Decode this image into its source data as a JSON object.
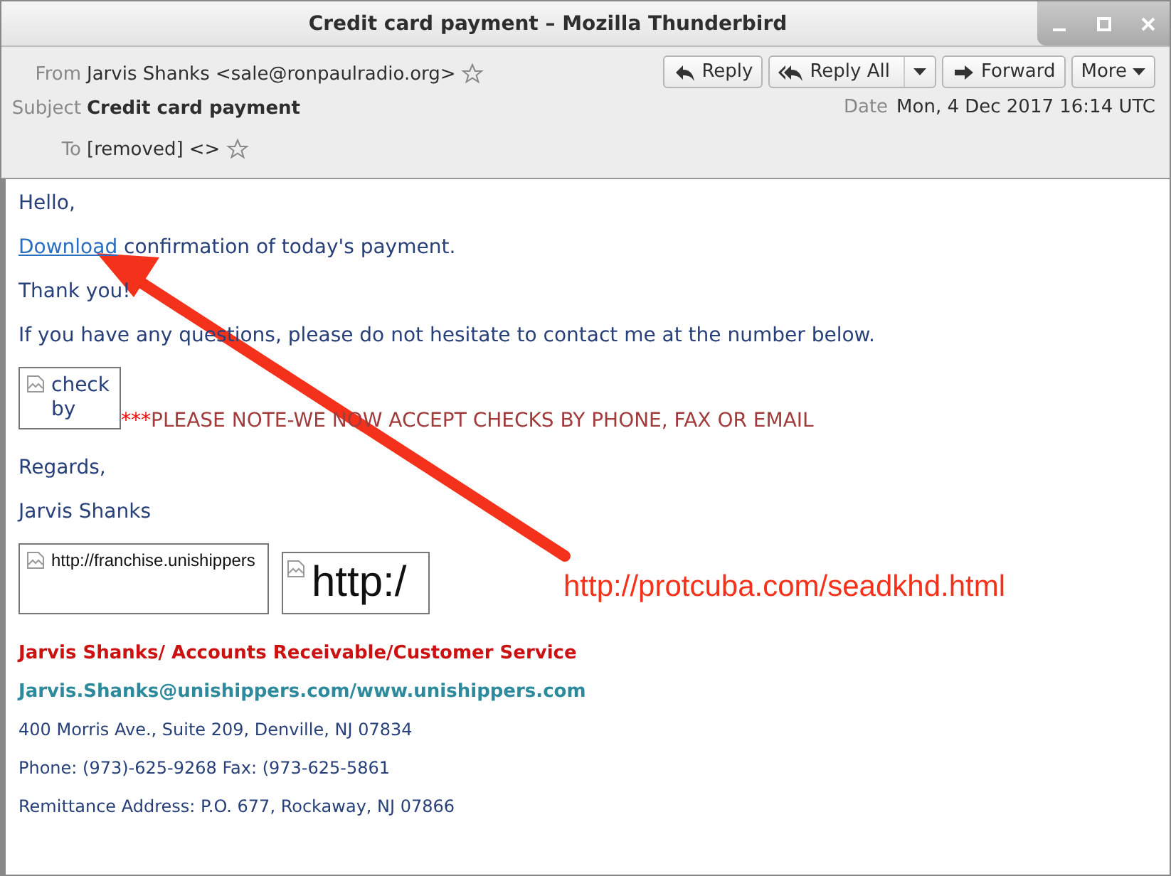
{
  "window": {
    "title": "Credit card payment – Mozilla Thunderbird",
    "controls": [
      {
        "kind": "minimize"
      },
      {
        "kind": "maximize"
      },
      {
        "kind": "close"
      }
    ]
  },
  "header": {
    "fields": [
      {
        "kind": "from",
        "label": "From",
        "value": "Jarvis Shanks <sale@ronpaulradio.org>",
        "starred": false
      },
      {
        "kind": "subject",
        "label": "Subject",
        "value": "Credit card payment"
      },
      {
        "kind": "to",
        "label": "To",
        "value": "[removed] <>",
        "starred": false
      }
    ],
    "date": {
      "label": "Date",
      "value": "Mon, 4 Dec 2017 16:14 UTC"
    },
    "buttons": [
      {
        "kind": "reply",
        "label": "Reply"
      },
      {
        "kind": "reply-all",
        "label": "Reply All"
      },
      {
        "kind": "forward",
        "label": "Forward"
      },
      {
        "kind": "more",
        "label": "More"
      }
    ]
  },
  "body": [
    {
      "kind": "text",
      "text": "Hello,"
    },
    {
      "kind": "link",
      "link": "Download",
      "text": "confirmation of today's payment."
    },
    {
      "kind": "text",
      "text": "Thank you!"
    },
    {
      "kind": "text",
      "text": "If you have any questions, please do not hesitate to contact me at the number below."
    },
    {
      "kind": "notice",
      "image_alt": "check by",
      "marks": "***",
      "text": "PLEASE NOTE-WE NOW ACCEPT CHECKS BY PHONE, FAX OR EMAIL"
    },
    {
      "kind": "text",
      "text": "Regards,"
    },
    {
      "kind": "text",
      "text": "Jarvis Shanks"
    },
    {
      "kind": "images",
      "images": [
        {
          "kind": "small",
          "alt": "http://franchise.unishippers"
        },
        {
          "kind": "large",
          "alt": "http:/"
        }
      ]
    },
    {
      "kind": "sig-name",
      "text": "Jarvis Shanks/ Accounts Receivable/Customer Service"
    },
    {
      "kind": "sig-email",
      "text": "Jarvis.Shanks@unishippers.com/www.unishippers.com"
    },
    {
      "kind": "sig-line",
      "text": "400 Morris Ave., Suite 209, Denville, NJ 07834"
    },
    {
      "kind": "sig-line",
      "text": "Phone: (973)-625-9268 Fax: (973-625-5861"
    },
    {
      "kind": "sig-line",
      "text": "Remittance Address: P.O. 677, Rockaway, NJ 07866"
    }
  ],
  "annotation": {
    "text": "http://protcuba.com/seadkhd.html"
  }
}
